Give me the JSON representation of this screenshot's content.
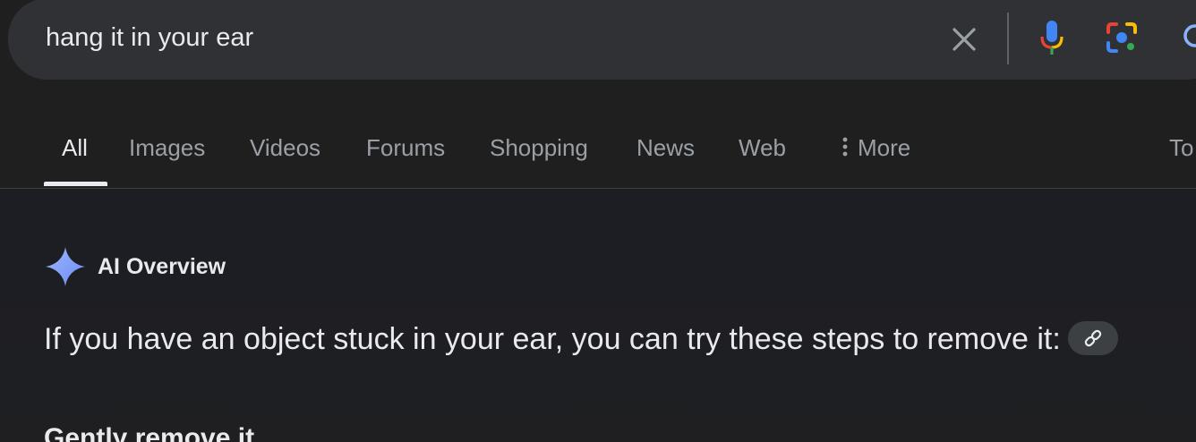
{
  "search": {
    "query": "hang it in your ear"
  },
  "icons": {
    "clear": "close-icon",
    "mic": "microphone-icon",
    "lens": "google-lens-icon",
    "search": "search-icon",
    "more": "vertical-dots-icon",
    "ai": "sparkle-icon",
    "link": "link-icon"
  },
  "tabs": {
    "all": "All",
    "images": "Images",
    "videos": "Videos",
    "forums": "Forums",
    "shopping": "Shopping",
    "news": "News",
    "web": "Web",
    "more": "More",
    "tools": "To"
  },
  "ai_overview": {
    "title": "AI Overview",
    "intro": "If you have an object stuck in your ear, you can try these steps to remove it:",
    "first_step": "Gently remove it"
  },
  "colors": {
    "background": "#1f1f1f",
    "search_bg": "#303134",
    "text_primary": "#e8eaed",
    "text_secondary": "#9aa0a6",
    "sparkle": "#8ab4f8"
  }
}
